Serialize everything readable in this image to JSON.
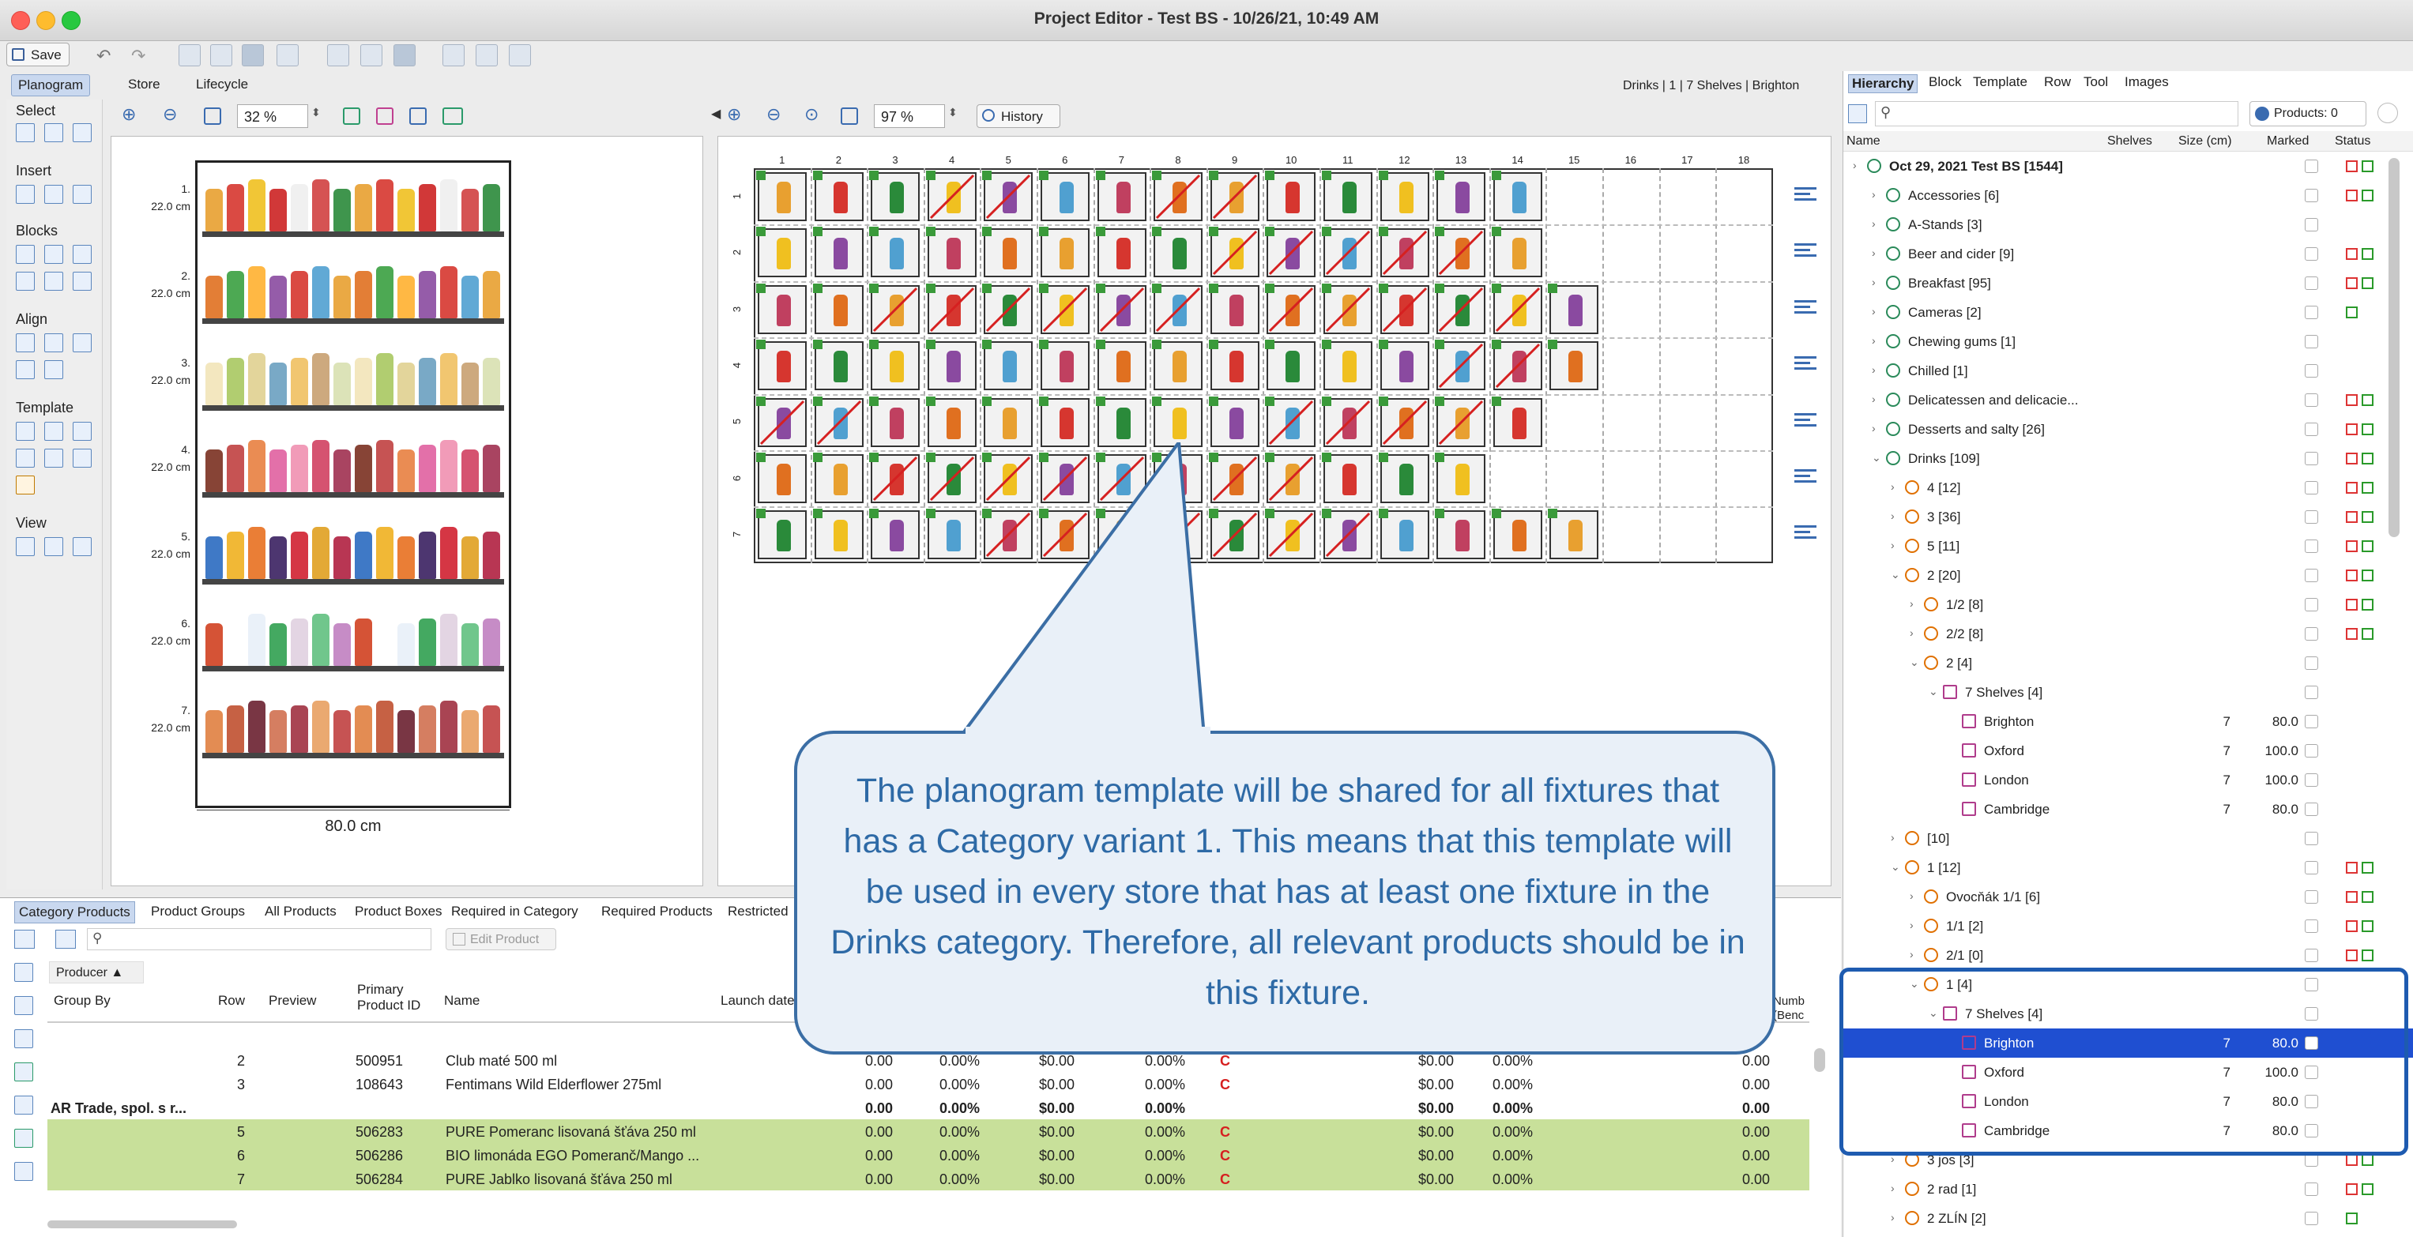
{
  "window": {
    "title": "Project Editor - Test BS - 10/26/21, 10:49 AM"
  },
  "toolbar": {
    "save_label": "Save"
  },
  "main_tabs": [
    {
      "label": "Planogram",
      "active": true
    },
    {
      "label": "Store",
      "active": false
    },
    {
      "label": "Lifecycle",
      "active": false
    }
  ],
  "breadcrumb": "Drinks | 1 | 7 Shelves | Brighton",
  "palette": {
    "sections": [
      "Select",
      "Insert",
      "Blocks",
      "Align",
      "Template",
      "View"
    ]
  },
  "left_view": {
    "zoom": "32 %",
    "shelf_labels": [
      {
        "num": "1.",
        "height": "22.0 cm"
      },
      {
        "num": "2.",
        "height": "22.0 cm"
      },
      {
        "num": "3.",
        "height": "22.0 cm"
      },
      {
        "num": "4.",
        "height": "22.0 cm"
      },
      {
        "num": "5.",
        "height": "22.0 cm"
      },
      {
        "num": "6.",
        "height": "22.0 cm"
      },
      {
        "num": "7.",
        "height": "22.0 cm"
      }
    ],
    "width_label": "80.0 cm"
  },
  "center_view": {
    "zoom": "97 %",
    "history_label": "History",
    "columns": [
      "1",
      "2",
      "3",
      "4",
      "5",
      "6",
      "7",
      "8",
      "9",
      "10",
      "11",
      "12",
      "13",
      "14",
      "15",
      "16",
      "17",
      "18"
    ],
    "rows": [
      "1",
      "2",
      "3",
      "4",
      "5",
      "6",
      "7"
    ]
  },
  "hierarchy": {
    "tabs": [
      "Hierarchy",
      "Block",
      "Template",
      "Row",
      "Tool",
      "Images"
    ],
    "products_filter": "Products: 0",
    "columns": {
      "name": "Name",
      "shelves": "Shelves",
      "size": "Size (cm)",
      "marked": "Marked",
      "status": "Status"
    },
    "rows": [
      {
        "name": "Oct 29, 2021 Test BS [1544]",
        "indent": 0,
        "icon": "root",
        "status": "rg",
        "bold": true
      },
      {
        "name": "Accessories [6]",
        "indent": 1,
        "icon": "cat",
        "status": "rg"
      },
      {
        "name": "A-Stands [3]",
        "indent": 1,
        "icon": "cat",
        "status": ""
      },
      {
        "name": "Beer and cider [9]",
        "indent": 1,
        "icon": "cat",
        "status": "rg"
      },
      {
        "name": "Breakfast [95]",
        "indent": 1,
        "icon": "cat",
        "status": "rg"
      },
      {
        "name": "Cameras [2]",
        "indent": 1,
        "icon": "cat",
        "status": "g"
      },
      {
        "name": "Chewing gums [1]",
        "indent": 1,
        "icon": "cat",
        "status": ""
      },
      {
        "name": "Chilled [1]",
        "indent": 1,
        "icon": "cat",
        "status": ""
      },
      {
        "name": "Delicatessen and delicacie...",
        "indent": 1,
        "icon": "cat",
        "status": "rg"
      },
      {
        "name": "Desserts and salty [26]",
        "indent": 1,
        "icon": "cat",
        "status": "rg"
      },
      {
        "name": "Drinks [109]",
        "indent": 1,
        "icon": "cat",
        "status": "rg",
        "open": true
      },
      {
        "name": "4 [12]",
        "indent": 2,
        "icon": "var",
        "status": "rg"
      },
      {
        "name": "3 [36]",
        "indent": 2,
        "icon": "var",
        "status": "rg"
      },
      {
        "name": "5 [11]",
        "indent": 2,
        "icon": "var",
        "status": "rg"
      },
      {
        "name": "2 [20]",
        "indent": 2,
        "icon": "var",
        "status": "rg",
        "open": true
      },
      {
        "name": "1/2 [8]",
        "indent": 3,
        "icon": "fix",
        "status": "rg"
      },
      {
        "name": "2/2 [8]",
        "indent": 3,
        "icon": "fix",
        "status": "rg"
      },
      {
        "name": "2 [4]",
        "indent": 3,
        "icon": "fix",
        "status": "",
        "open": true
      },
      {
        "name": "7 Shelves [4]",
        "indent": 4,
        "icon": "tpl",
        "status": "",
        "open": true
      },
      {
        "name": "Brighton",
        "indent": 5,
        "icon": "store",
        "shelves": "7",
        "size": "80.0",
        "status": ""
      },
      {
        "name": "Oxford",
        "indent": 5,
        "icon": "store",
        "shelves": "7",
        "size": "100.0",
        "status": ""
      },
      {
        "name": "London",
        "indent": 5,
        "icon": "store",
        "shelves": "7",
        "size": "100.0",
        "status": ""
      },
      {
        "name": "Cambridge",
        "indent": 5,
        "icon": "store",
        "shelves": "7",
        "size": "80.0",
        "status": ""
      },
      {
        "name": "[10]",
        "indent": 2,
        "icon": "var",
        "status": ""
      },
      {
        "name": "1 [12]",
        "indent": 2,
        "icon": "var",
        "status": "rg",
        "open": true
      },
      {
        "name": "Ovocňák 1/1 [6]",
        "indent": 3,
        "icon": "fix",
        "status": "rg"
      },
      {
        "name": "1/1 [2]",
        "indent": 3,
        "icon": "fix",
        "status": "rg"
      },
      {
        "name": "2/1 [0]",
        "indent": 3,
        "icon": "fix",
        "status": "rg"
      },
      {
        "name": "1 [4]",
        "indent": 3,
        "icon": "fix",
        "status": "",
        "open": true
      },
      {
        "name": "7 Shelves [4]",
        "indent": 4,
        "icon": "tpl",
        "status": "",
        "open": true
      },
      {
        "name": "Brighton",
        "indent": 5,
        "icon": "store",
        "shelves": "7",
        "size": "80.0",
        "status": "",
        "selected": true
      },
      {
        "name": "Oxford",
        "indent": 5,
        "icon": "store",
        "shelves": "7",
        "size": "100.0",
        "status": ""
      },
      {
        "name": "London",
        "indent": 5,
        "icon": "store",
        "shelves": "7",
        "size": "80.0",
        "status": ""
      },
      {
        "name": "Cambridge",
        "indent": 5,
        "icon": "store",
        "shelves": "7",
        "size": "80.0",
        "status": ""
      },
      {
        "name": "3 jos [3]",
        "indent": 2,
        "icon": "var",
        "status": "rg"
      },
      {
        "name": "2 rad [1]",
        "indent": 2,
        "icon": "var",
        "status": "rg"
      },
      {
        "name": "2 ZLÍN [2]",
        "indent": 2,
        "icon": "var",
        "status": "g"
      }
    ]
  },
  "bottom": {
    "tabs": [
      "Category Products",
      "Product Groups",
      "All Products",
      "Product Boxes",
      "Required in Category",
      "Required Products",
      "Restricted"
    ],
    "edit_product_label": "Edit Product",
    "group_chip": "Producer",
    "headers": {
      "group_by": "Group By",
      "row": "Row",
      "preview": "Preview",
      "primary_id": "Primary Product ID",
      "name": "Name",
      "launch": "Launch date",
      "numb": "Numb (Benc"
    },
    "rows": [
      {
        "group": "",
        "row": "2",
        "id": "500951",
        "name": "Club maté 500 ml",
        "v": [
          "0.00",
          "0.00%",
          "$0.00",
          "0.00%",
          "$0.00",
          "0.00%",
          "0.00"
        ],
        "style": ""
      },
      {
        "group": "",
        "row": "3",
        "id": "108643",
        "name": "Fentimans Wild Elderflower 275ml",
        "v": [
          "0.00",
          "0.00%",
          "$0.00",
          "0.00%",
          "$0.00",
          "0.00%",
          "0.00"
        ],
        "style": ""
      },
      {
        "group": "AR Trade, spol. s r...",
        "row": "",
        "id": "",
        "name": "",
        "v": [
          "0.00",
          "0.00%",
          "$0.00",
          "0.00%",
          "$0.00",
          "0.00%",
          "0.00"
        ],
        "style": "bold"
      },
      {
        "group": "",
        "row": "5",
        "id": "506283",
        "name": "PURE Pomeranc lisovaná šťáva 250 ml",
        "v": [
          "0.00",
          "0.00%",
          "$0.00",
          "0.00%",
          "$0.00",
          "0.00%",
          "0.00"
        ],
        "style": "green"
      },
      {
        "group": "",
        "row": "6",
        "id": "506286",
        "name": "BIO limonáda EGO Pomeranč/Mango ...",
        "v": [
          "0.00",
          "0.00%",
          "$0.00",
          "0.00%",
          "$0.00",
          "0.00%",
          "0.00"
        ],
        "style": "green"
      },
      {
        "group": "",
        "row": "7",
        "id": "506284",
        "name": "PURE Jablko lisovaná šťáva 250 ml",
        "v": [
          "0.00",
          "0.00%",
          "$0.00",
          "0.00%",
          "$0.00",
          "0.00%",
          "0.00"
        ],
        "style": "green"
      }
    ]
  },
  "callout": {
    "text": "The planogram template will be shared for all fixtures that has a Category variant 1. This means that this template will be used in every store that has at least one fixture in the Drinks category. Therefore, all relevant products should be in this fixture."
  },
  "colors": {
    "accent": "#2e6aa6",
    "selected": "#1f4fd1",
    "green_row": "#c8e09a"
  }
}
